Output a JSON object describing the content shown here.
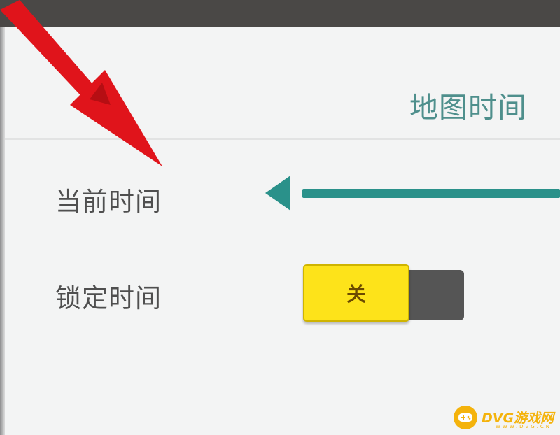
{
  "panel": {
    "title": "地图时间"
  },
  "settings": {
    "current_time": {
      "label": "当前时间",
      "slider_value_fraction": 0.0
    },
    "lock_time": {
      "label": "锁定时间",
      "toggle_state_label": "关",
      "enabled": false
    }
  },
  "annotation": {
    "arrow_color": "#e0141b"
  },
  "watermark": {
    "brand": "DVG游戏网",
    "sub": "WWW.DVG.CN",
    "icon": "gamepad-icon",
    "color": "#f4b30c"
  },
  "colors": {
    "accent": "#2a918a",
    "toggle_yellow": "#fde31a",
    "toggle_dark": "#555555",
    "title": "#4e8f8c"
  }
}
